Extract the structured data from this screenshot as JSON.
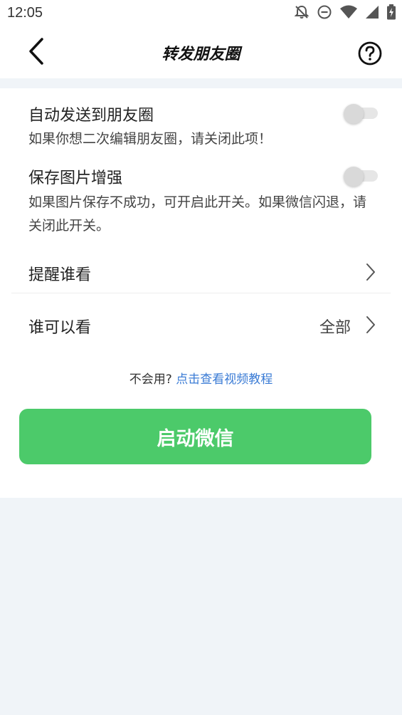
{
  "status_bar": {
    "time": "12:05",
    "icons": [
      "bell-off-icon",
      "do-not-disturb-icon",
      "wifi-icon",
      "signal-icon",
      "battery-charging-icon"
    ]
  },
  "header": {
    "title": "转发朋友圈",
    "back_icon": "chevron-left-icon",
    "help_icon": "question-circle-icon"
  },
  "settings": {
    "auto_send": {
      "title": "自动发送到朋友圈",
      "desc": "如果你想二次编辑朋友圈，请关闭此项！",
      "enabled": false
    },
    "image_enhance": {
      "title": "保存图片增强",
      "desc": "如果图片保存不成功，可开启此开关。如果微信闪退，请关闭此开关。",
      "enabled": false
    }
  },
  "rows": {
    "remind": {
      "label": "提醒谁看"
    },
    "visibility": {
      "label": "谁可以看",
      "value": "全部"
    }
  },
  "help": {
    "prefix": "不会用?",
    "link": "点击查看视频教程"
  },
  "launch_button": {
    "label": "启动微信"
  },
  "colors": {
    "accent_green": "#4cca6a",
    "link_blue": "#3a7bd5",
    "background": "#f0f4f8"
  }
}
